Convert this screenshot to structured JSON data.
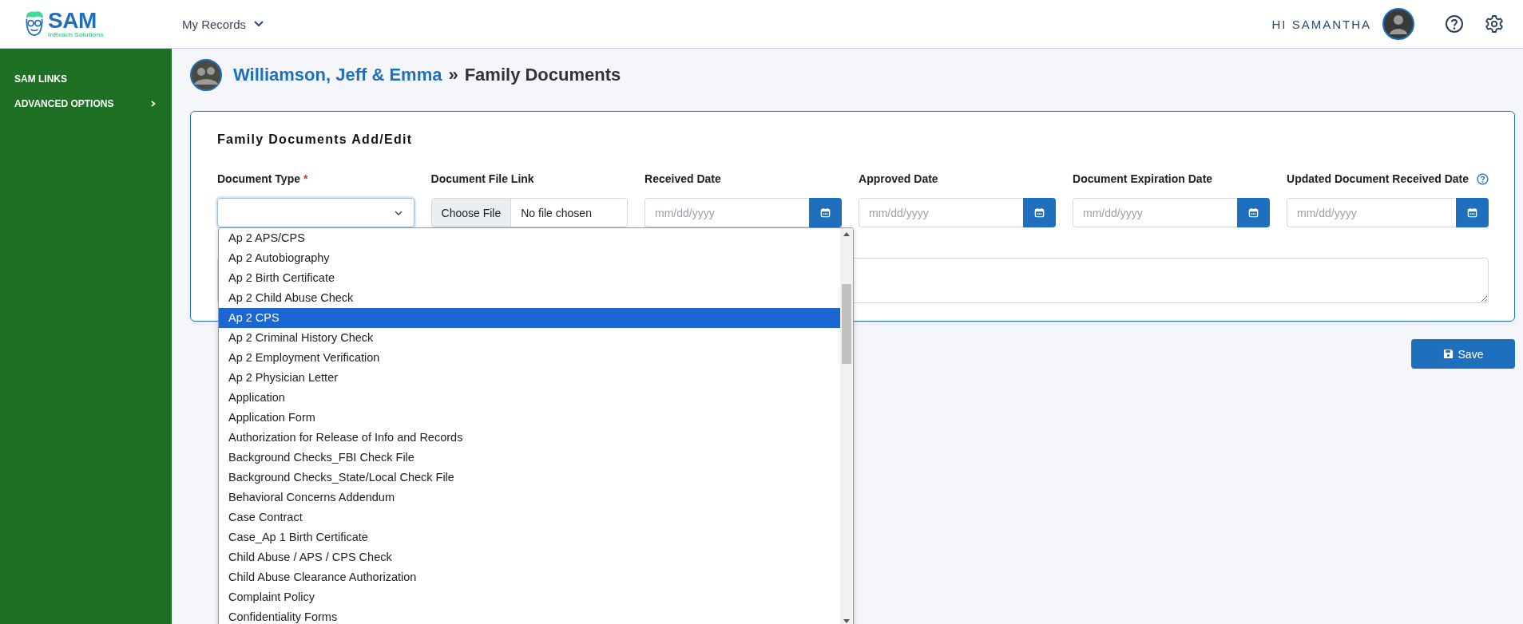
{
  "header": {
    "logo": {
      "name": "SAM",
      "tagline": "InReach Solutions"
    },
    "menu": "My Records",
    "greeting": "HI SAMANTHA"
  },
  "sidebar": {
    "items": [
      {
        "label": "SAM LINKS",
        "expandable": false
      },
      {
        "label": "ADVANCED OPTIONS",
        "expandable": true
      }
    ]
  },
  "breadcrumb": {
    "family": "Williamson, Jeff & Emma",
    "separator": "»",
    "page": "Family Documents"
  },
  "form": {
    "title": "Family Documents Add/Edit",
    "required_mark": "*",
    "fields": [
      {
        "kind": "select",
        "label": "Document Type",
        "required": true,
        "help": false
      },
      {
        "kind": "file",
        "label": "Document File Link",
        "required": false,
        "help": false,
        "button": "Choose File",
        "value": "No file chosen"
      },
      {
        "kind": "date",
        "label": "Received Date",
        "required": false,
        "help": false,
        "placeholder": "mm/dd/yyyy"
      },
      {
        "kind": "date",
        "label": "Approved Date",
        "required": false,
        "help": false,
        "placeholder": "mm/dd/yyyy"
      },
      {
        "kind": "date",
        "label": "Document Expiration Date",
        "required": false,
        "help": false,
        "placeholder": "mm/dd/yyyy"
      },
      {
        "kind": "date",
        "label": "Updated Document Received Date",
        "required": false,
        "help": true,
        "placeholder": "mm/dd/yyyy"
      }
    ]
  },
  "dropdown": {
    "options": [
      {
        "label": "Ap 2 APS/CPS",
        "selected": false
      },
      {
        "label": "Ap 2 Autobiography",
        "selected": false
      },
      {
        "label": "Ap 2 Birth Certificate",
        "selected": false
      },
      {
        "label": "Ap 2 Child Abuse Check",
        "selected": false
      },
      {
        "label": "Ap 2 CPS",
        "selected": true
      },
      {
        "label": "Ap 2 Criminal History Check",
        "selected": false
      },
      {
        "label": "Ap 2 Employment Verification",
        "selected": false
      },
      {
        "label": "Ap 2 Physician Letter",
        "selected": false
      },
      {
        "label": "Application",
        "selected": false
      },
      {
        "label": "Application Form",
        "selected": false
      },
      {
        "label": "Authorization for Release of Info and Records",
        "selected": false
      },
      {
        "label": "Background Checks_FBI Check File",
        "selected": false
      },
      {
        "label": "Background Checks_State/Local Check File",
        "selected": false
      },
      {
        "label": "Behavioral Concerns Addendum",
        "selected": false
      },
      {
        "label": "Case Contract",
        "selected": false
      },
      {
        "label": "Case_Ap 1 Birth Certificate",
        "selected": false
      },
      {
        "label": "Child Abuse / APS / CPS Check",
        "selected": false
      },
      {
        "label": "Child Abuse Clearance Authorization",
        "selected": false
      },
      {
        "label": "Complaint Policy",
        "selected": false
      },
      {
        "label": "Confidentiality Forms",
        "selected": false
      }
    ]
  },
  "save_button": "Save"
}
